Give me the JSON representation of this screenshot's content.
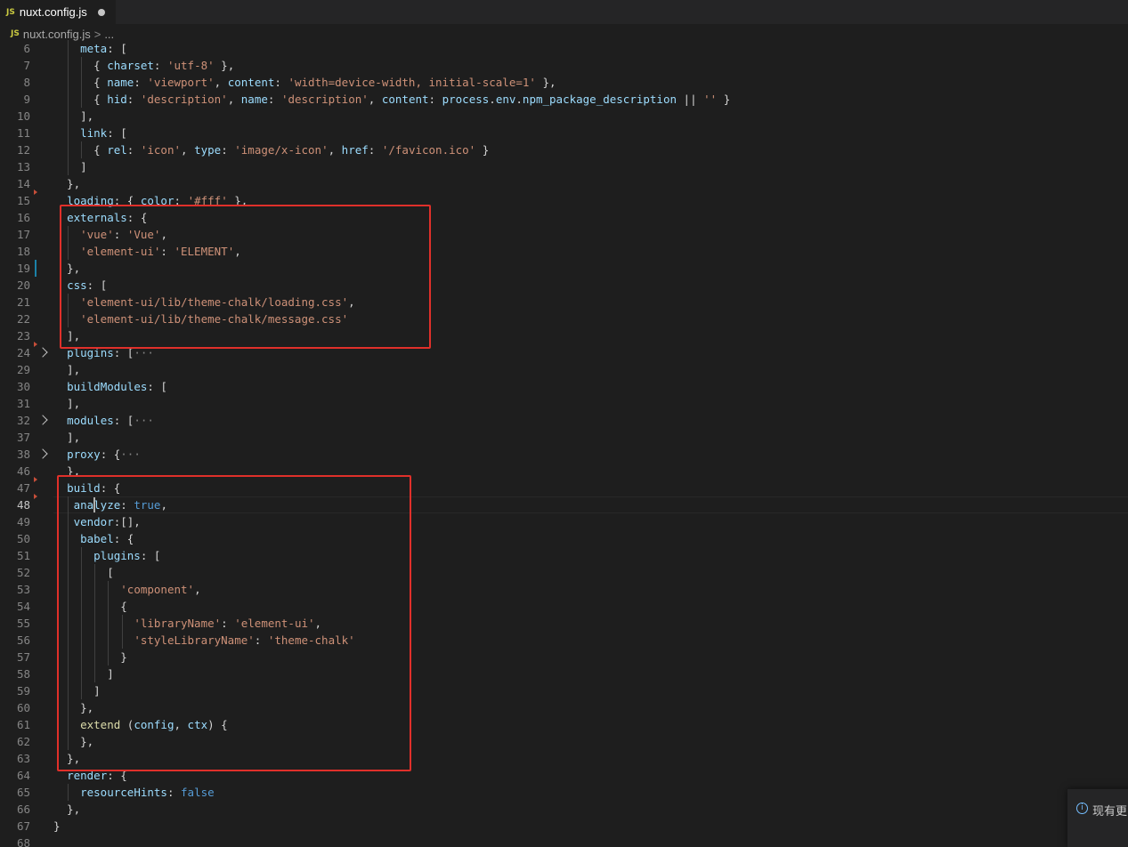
{
  "tab": {
    "icon": "js-file-icon",
    "badge": "JS",
    "title": "nuxt.config.js",
    "dirty": true
  },
  "breadcrumb": {
    "badge": "JS",
    "file": "nuxt.config.js",
    "separator": ">",
    "more": "..."
  },
  "editor": {
    "active_line": "48",
    "lines": [
      {
        "n": "6",
        "tokens": [
          [
            "p",
            "    "
          ],
          [
            "k",
            "meta"
          ],
          [
            "p",
            ": ["
          ]
        ]
      },
      {
        "n": "7",
        "tokens": [
          [
            "p",
            "      { "
          ],
          [
            "k",
            "charset"
          ],
          [
            "p",
            ": "
          ],
          [
            "s",
            "'utf-8'"
          ],
          [
            "p",
            " },"
          ]
        ]
      },
      {
        "n": "8",
        "tokens": [
          [
            "p",
            "      { "
          ],
          [
            "k",
            "name"
          ],
          [
            "p",
            ": "
          ],
          [
            "s",
            "'viewport'"
          ],
          [
            "p",
            ", "
          ],
          [
            "k",
            "content"
          ],
          [
            "p",
            ": "
          ],
          [
            "s",
            "'width=device-width, initial-scale=1'"
          ],
          [
            "p",
            " },"
          ]
        ]
      },
      {
        "n": "9",
        "tokens": [
          [
            "p",
            "      { "
          ],
          [
            "k",
            "hid"
          ],
          [
            "p",
            ": "
          ],
          [
            "s",
            "'description'"
          ],
          [
            "p",
            ", "
          ],
          [
            "k",
            "name"
          ],
          [
            "p",
            ": "
          ],
          [
            "s",
            "'description'"
          ],
          [
            "p",
            ", "
          ],
          [
            "k",
            "content"
          ],
          [
            "p",
            ": "
          ],
          [
            "k",
            "process"
          ],
          [
            "p",
            "."
          ],
          [
            "k",
            "env"
          ],
          [
            "p",
            "."
          ],
          [
            "k",
            "npm_package_description"
          ],
          [
            "p",
            " || "
          ],
          [
            "s",
            "''"
          ],
          [
            "p",
            " }"
          ]
        ]
      },
      {
        "n": "10",
        "tokens": [
          [
            "p",
            "    ],"
          ]
        ]
      },
      {
        "n": "11",
        "tokens": [
          [
            "p",
            "    "
          ],
          [
            "k",
            "link"
          ],
          [
            "p",
            ": ["
          ]
        ]
      },
      {
        "n": "12",
        "tokens": [
          [
            "p",
            "      { "
          ],
          [
            "k",
            "rel"
          ],
          [
            "p",
            ": "
          ],
          [
            "s",
            "'icon'"
          ],
          [
            "p",
            ", "
          ],
          [
            "k",
            "type"
          ],
          [
            "p",
            ": "
          ],
          [
            "s",
            "'image/x-icon'"
          ],
          [
            "p",
            ", "
          ],
          [
            "k",
            "href"
          ],
          [
            "p",
            ": "
          ],
          [
            "s",
            "'/favicon.ico'"
          ],
          [
            "p",
            " }"
          ]
        ]
      },
      {
        "n": "13",
        "tokens": [
          [
            "p",
            "    ]"
          ]
        ]
      },
      {
        "n": "14",
        "tokens": [
          [
            "p",
            "  },"
          ]
        ]
      },
      {
        "n": "15",
        "tokens": [
          [
            "p",
            "  "
          ],
          [
            "k",
            "loading"
          ],
          [
            "p",
            ": { "
          ],
          [
            "k",
            "color"
          ],
          [
            "p",
            ": "
          ],
          [
            "s",
            "'#fff'"
          ],
          [
            "p",
            " },"
          ]
        ]
      },
      {
        "n": "16",
        "tokens": [
          [
            "p",
            "  "
          ],
          [
            "k",
            "externals"
          ],
          [
            "p",
            ": {"
          ]
        ]
      },
      {
        "n": "17",
        "tokens": [
          [
            "p",
            "    "
          ],
          [
            "s",
            "'vue'"
          ],
          [
            "p",
            ": "
          ],
          [
            "s",
            "'Vue'"
          ],
          [
            "p",
            ","
          ]
        ]
      },
      {
        "n": "18",
        "tokens": [
          [
            "p",
            "    "
          ],
          [
            "s",
            "'element-ui'"
          ],
          [
            "p",
            ": "
          ],
          [
            "s",
            "'ELEMENT'"
          ],
          [
            "p",
            ","
          ]
        ]
      },
      {
        "n": "19",
        "tokens": [
          [
            "p",
            "  },"
          ]
        ]
      },
      {
        "n": "20",
        "tokens": [
          [
            "p",
            "  "
          ],
          [
            "k",
            "css"
          ],
          [
            "p",
            ": ["
          ]
        ]
      },
      {
        "n": "21",
        "tokens": [
          [
            "p",
            "    "
          ],
          [
            "s",
            "'element-ui/lib/theme-chalk/loading.css'"
          ],
          [
            "p",
            ","
          ]
        ]
      },
      {
        "n": "22",
        "tokens": [
          [
            "p",
            "    "
          ],
          [
            "s",
            "'element-ui/lib/theme-chalk/message.css'"
          ]
        ]
      },
      {
        "n": "23",
        "tokens": [
          [
            "p",
            "  ],"
          ]
        ]
      },
      {
        "n": "24",
        "tokens": [
          [
            "p",
            "  "
          ],
          [
            "k",
            "plugins"
          ],
          [
            "p",
            ": ["
          ],
          [
            "c",
            "···"
          ]
        ],
        "fold": true
      },
      {
        "n": "29",
        "tokens": [
          [
            "p",
            "  ],"
          ]
        ]
      },
      {
        "n": "30",
        "tokens": [
          [
            "p",
            "  "
          ],
          [
            "k",
            "buildModules"
          ],
          [
            "p",
            ": ["
          ]
        ]
      },
      {
        "n": "31",
        "tokens": [
          [
            "p",
            "  ],"
          ]
        ]
      },
      {
        "n": "32",
        "tokens": [
          [
            "p",
            "  "
          ],
          [
            "k",
            "modules"
          ],
          [
            "p",
            ": ["
          ],
          [
            "c",
            "···"
          ]
        ],
        "fold": true
      },
      {
        "n": "37",
        "tokens": [
          [
            "p",
            "  ],"
          ]
        ]
      },
      {
        "n": "38",
        "tokens": [
          [
            "p",
            "  "
          ],
          [
            "k",
            "proxy"
          ],
          [
            "p",
            ": {"
          ],
          [
            "c",
            "···"
          ]
        ],
        "fold": true
      },
      {
        "n": "46",
        "tokens": [
          [
            "p",
            "  },"
          ]
        ]
      },
      {
        "n": "47",
        "tokens": [
          [
            "p",
            "  "
          ],
          [
            "k",
            "build"
          ],
          [
            "p",
            ": {"
          ]
        ]
      },
      {
        "n": "48",
        "tokens": [
          [
            "p",
            "   "
          ],
          [
            "k",
            "analyze"
          ],
          [
            "p",
            ": "
          ],
          [
            "b",
            "true"
          ],
          [
            "p",
            ","
          ]
        ]
      },
      {
        "n": "49",
        "tokens": [
          [
            "p",
            "   "
          ],
          [
            "k",
            "vendor"
          ],
          [
            "p",
            ":[],"
          ]
        ]
      },
      {
        "n": "50",
        "tokens": [
          [
            "p",
            "    "
          ],
          [
            "k",
            "babel"
          ],
          [
            "p",
            ": {"
          ]
        ]
      },
      {
        "n": "51",
        "tokens": [
          [
            "p",
            "      "
          ],
          [
            "k",
            "plugins"
          ],
          [
            "p",
            ": ["
          ]
        ]
      },
      {
        "n": "52",
        "tokens": [
          [
            "p",
            "        ["
          ]
        ]
      },
      {
        "n": "53",
        "tokens": [
          [
            "p",
            "          "
          ],
          [
            "s",
            "'component'"
          ],
          [
            "p",
            ","
          ]
        ]
      },
      {
        "n": "54",
        "tokens": [
          [
            "p",
            "          {"
          ]
        ]
      },
      {
        "n": "55",
        "tokens": [
          [
            "p",
            "            "
          ],
          [
            "s",
            "'libraryName'"
          ],
          [
            "p",
            ": "
          ],
          [
            "s",
            "'element-ui'"
          ],
          [
            "p",
            ","
          ]
        ]
      },
      {
        "n": "56",
        "tokens": [
          [
            "p",
            "            "
          ],
          [
            "s",
            "'styleLibraryName'"
          ],
          [
            "p",
            ": "
          ],
          [
            "s",
            "'theme-chalk'"
          ]
        ]
      },
      {
        "n": "57",
        "tokens": [
          [
            "p",
            "          }"
          ]
        ]
      },
      {
        "n": "58",
        "tokens": [
          [
            "p",
            "        ]"
          ]
        ]
      },
      {
        "n": "59",
        "tokens": [
          [
            "p",
            "      ]"
          ]
        ]
      },
      {
        "n": "60",
        "tokens": [
          [
            "p",
            "    },"
          ]
        ]
      },
      {
        "n": "61",
        "tokens": [
          [
            "p",
            "    "
          ],
          [
            "f",
            "extend"
          ],
          [
            "p",
            " ("
          ],
          [
            "k",
            "config"
          ],
          [
            "p",
            ", "
          ],
          [
            "k",
            "ctx"
          ],
          [
            "p",
            ") {"
          ]
        ]
      },
      {
        "n": "62",
        "tokens": [
          [
            "p",
            "    },"
          ]
        ]
      },
      {
        "n": "63",
        "tokens": [
          [
            "p",
            "  },"
          ]
        ]
      },
      {
        "n": "64",
        "tokens": [
          [
            "p",
            "  "
          ],
          [
            "k",
            "render"
          ],
          [
            "p",
            ": {"
          ]
        ]
      },
      {
        "n": "65",
        "tokens": [
          [
            "p",
            "    "
          ],
          [
            "k",
            "resourceHints"
          ],
          [
            "p",
            ": "
          ],
          [
            "b",
            "false"
          ]
        ]
      },
      {
        "n": "66",
        "tokens": [
          [
            "p",
            "  },"
          ]
        ]
      },
      {
        "n": "67",
        "tokens": [
          [
            "p",
            "}"
          ]
        ]
      },
      {
        "n": "68",
        "tokens": []
      }
    ]
  },
  "notification": {
    "icon": "info-icon",
    "text": "现有更"
  },
  "colors": {
    "keyword": "#9cdcfe",
    "string": "#ce9178",
    "boolean": "#569cd6",
    "function": "#dcdcaa",
    "highlight_box": "#e0302a"
  }
}
